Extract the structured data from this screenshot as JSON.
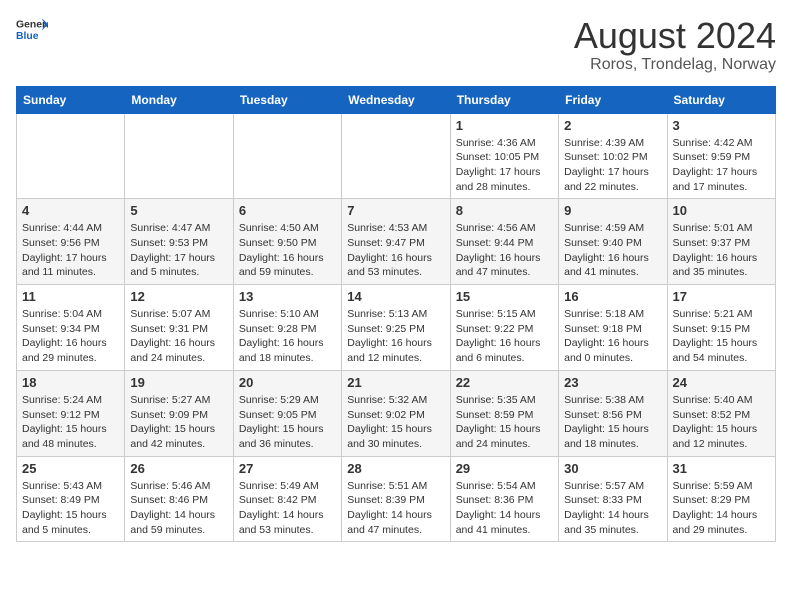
{
  "header": {
    "logo_line1": "General",
    "logo_line2": "Blue",
    "title": "August 2024",
    "subtitle": "Roros, Trondelag, Norway"
  },
  "days_of_week": [
    "Sunday",
    "Monday",
    "Tuesday",
    "Wednesday",
    "Thursday",
    "Friday",
    "Saturday"
  ],
  "weeks": [
    [
      {
        "day": "",
        "info": ""
      },
      {
        "day": "",
        "info": ""
      },
      {
        "day": "",
        "info": ""
      },
      {
        "day": "",
        "info": ""
      },
      {
        "day": "1",
        "info": "Sunrise: 4:36 AM\nSunset: 10:05 PM\nDaylight: 17 hours\nand 28 minutes."
      },
      {
        "day": "2",
        "info": "Sunrise: 4:39 AM\nSunset: 10:02 PM\nDaylight: 17 hours\nand 22 minutes."
      },
      {
        "day": "3",
        "info": "Sunrise: 4:42 AM\nSunset: 9:59 PM\nDaylight: 17 hours\nand 17 minutes."
      }
    ],
    [
      {
        "day": "4",
        "info": "Sunrise: 4:44 AM\nSunset: 9:56 PM\nDaylight: 17 hours\nand 11 minutes."
      },
      {
        "day": "5",
        "info": "Sunrise: 4:47 AM\nSunset: 9:53 PM\nDaylight: 17 hours\nand 5 minutes."
      },
      {
        "day": "6",
        "info": "Sunrise: 4:50 AM\nSunset: 9:50 PM\nDaylight: 16 hours\nand 59 minutes."
      },
      {
        "day": "7",
        "info": "Sunrise: 4:53 AM\nSunset: 9:47 PM\nDaylight: 16 hours\nand 53 minutes."
      },
      {
        "day": "8",
        "info": "Sunrise: 4:56 AM\nSunset: 9:44 PM\nDaylight: 16 hours\nand 47 minutes."
      },
      {
        "day": "9",
        "info": "Sunrise: 4:59 AM\nSunset: 9:40 PM\nDaylight: 16 hours\nand 41 minutes."
      },
      {
        "day": "10",
        "info": "Sunrise: 5:01 AM\nSunset: 9:37 PM\nDaylight: 16 hours\nand 35 minutes."
      }
    ],
    [
      {
        "day": "11",
        "info": "Sunrise: 5:04 AM\nSunset: 9:34 PM\nDaylight: 16 hours\nand 29 minutes."
      },
      {
        "day": "12",
        "info": "Sunrise: 5:07 AM\nSunset: 9:31 PM\nDaylight: 16 hours\nand 24 minutes."
      },
      {
        "day": "13",
        "info": "Sunrise: 5:10 AM\nSunset: 9:28 PM\nDaylight: 16 hours\nand 18 minutes."
      },
      {
        "day": "14",
        "info": "Sunrise: 5:13 AM\nSunset: 9:25 PM\nDaylight: 16 hours\nand 12 minutes."
      },
      {
        "day": "15",
        "info": "Sunrise: 5:15 AM\nSunset: 9:22 PM\nDaylight: 16 hours\nand 6 minutes."
      },
      {
        "day": "16",
        "info": "Sunrise: 5:18 AM\nSunset: 9:18 PM\nDaylight: 16 hours\nand 0 minutes."
      },
      {
        "day": "17",
        "info": "Sunrise: 5:21 AM\nSunset: 9:15 PM\nDaylight: 15 hours\nand 54 minutes."
      }
    ],
    [
      {
        "day": "18",
        "info": "Sunrise: 5:24 AM\nSunset: 9:12 PM\nDaylight: 15 hours\nand 48 minutes."
      },
      {
        "day": "19",
        "info": "Sunrise: 5:27 AM\nSunset: 9:09 PM\nDaylight: 15 hours\nand 42 minutes."
      },
      {
        "day": "20",
        "info": "Sunrise: 5:29 AM\nSunset: 9:05 PM\nDaylight: 15 hours\nand 36 minutes."
      },
      {
        "day": "21",
        "info": "Sunrise: 5:32 AM\nSunset: 9:02 PM\nDaylight: 15 hours\nand 30 minutes."
      },
      {
        "day": "22",
        "info": "Sunrise: 5:35 AM\nSunset: 8:59 PM\nDaylight: 15 hours\nand 24 minutes."
      },
      {
        "day": "23",
        "info": "Sunrise: 5:38 AM\nSunset: 8:56 PM\nDaylight: 15 hours\nand 18 minutes."
      },
      {
        "day": "24",
        "info": "Sunrise: 5:40 AM\nSunset: 8:52 PM\nDaylight: 15 hours\nand 12 minutes."
      }
    ],
    [
      {
        "day": "25",
        "info": "Sunrise: 5:43 AM\nSunset: 8:49 PM\nDaylight: 15 hours\nand 5 minutes."
      },
      {
        "day": "26",
        "info": "Sunrise: 5:46 AM\nSunset: 8:46 PM\nDaylight: 14 hours\nand 59 minutes."
      },
      {
        "day": "27",
        "info": "Sunrise: 5:49 AM\nSunset: 8:42 PM\nDaylight: 14 hours\nand 53 minutes."
      },
      {
        "day": "28",
        "info": "Sunrise: 5:51 AM\nSunset: 8:39 PM\nDaylight: 14 hours\nand 47 minutes."
      },
      {
        "day": "29",
        "info": "Sunrise: 5:54 AM\nSunset: 8:36 PM\nDaylight: 14 hours\nand 41 minutes."
      },
      {
        "day": "30",
        "info": "Sunrise: 5:57 AM\nSunset: 8:33 PM\nDaylight: 14 hours\nand 35 minutes."
      },
      {
        "day": "31",
        "info": "Sunrise: 5:59 AM\nSunset: 8:29 PM\nDaylight: 14 hours\nand 29 minutes."
      }
    ]
  ]
}
